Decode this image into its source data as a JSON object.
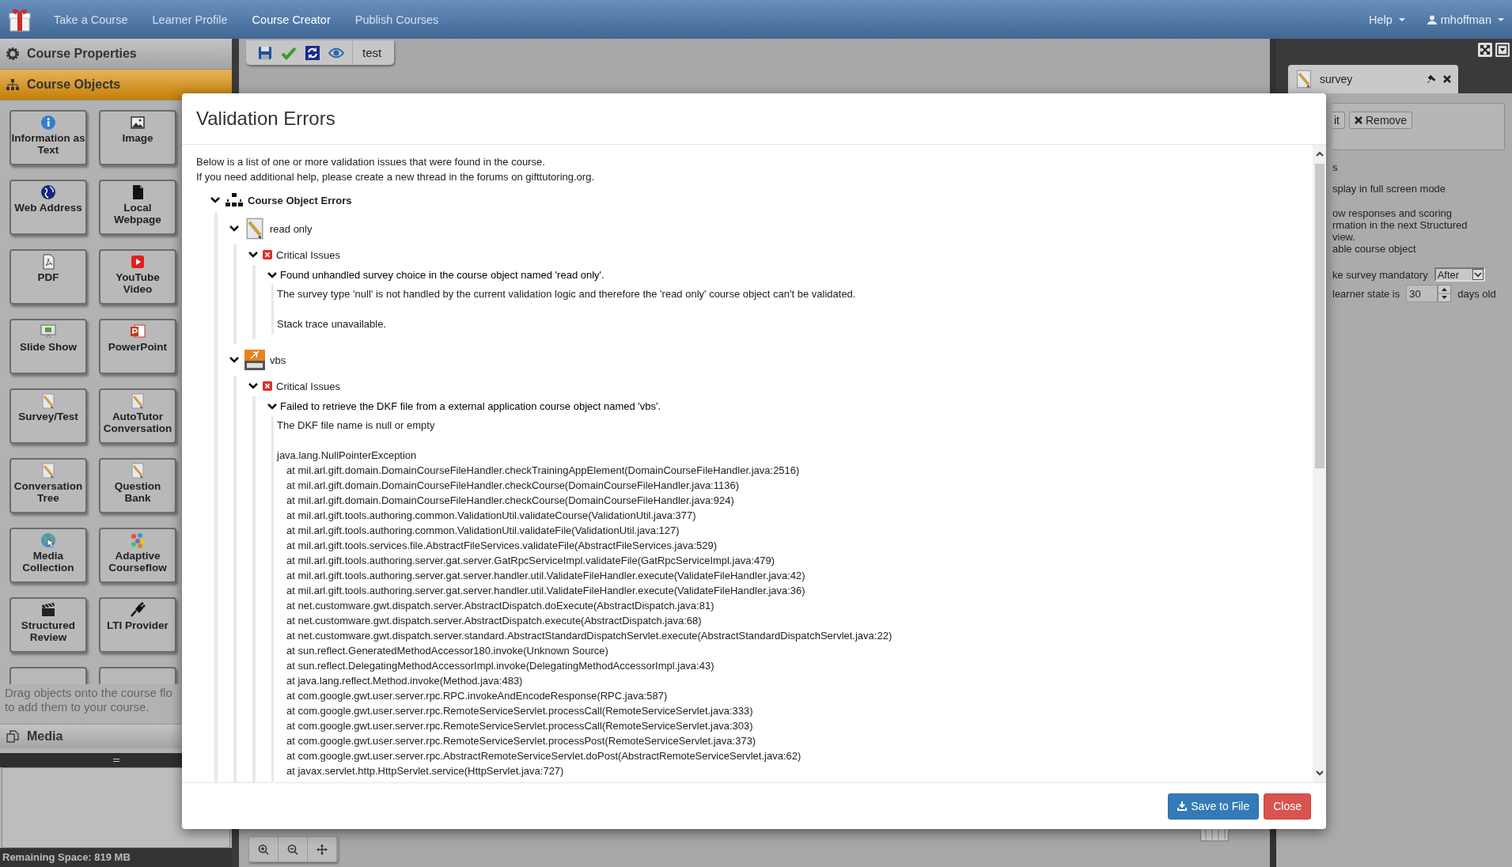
{
  "navbar": {
    "items": [
      {
        "label": "Take a Course",
        "selected": false
      },
      {
        "label": "Learner Profile",
        "selected": false
      },
      {
        "label": "Course Creator",
        "selected": true
      },
      {
        "label": "Publish Courses",
        "selected": false
      }
    ],
    "help": "Help",
    "user": "mhoffman"
  },
  "sidebar": {
    "sections": [
      {
        "label": "Course Properties",
        "selected": false
      },
      {
        "label": "Course Objects",
        "selected": true
      }
    ],
    "objects": [
      "Information as Text",
      "Image",
      "Web Address",
      "Local Webpage",
      "PDF",
      "YouTube Video",
      "Slide Show",
      "PowerPoint",
      "Survey/Test",
      "AutoTutor Conversation",
      "Conversation Tree",
      "Question Bank",
      "Media Collection",
      "Adaptive Courseflow",
      "Structured Review",
      "LTI Provider"
    ],
    "hint": [
      "Drag objects onto the course flo",
      "to add them to your course."
    ],
    "media": "Media",
    "storage": "Remaining Space: 819 MB"
  },
  "toolbar": {
    "course_name": "test"
  },
  "properties_panel": {
    "tab": "survey",
    "edit_fragment": "it",
    "remove": "Remove",
    "lines": [
      "s",
      "splay in full screen mode"
    ],
    "description": [
      "ow responses and scoring",
      "rmation in the next Structured",
      "view.",
      "able course object"
    ],
    "mandatory": {
      "label": "ke survey mandatory",
      "value": "After"
    },
    "age": {
      "label": "learner state is",
      "value": "30",
      "unit": "days old"
    }
  },
  "modal": {
    "title": "Validation Errors",
    "intro": [
      "Below is a list of one or more validation issues that were found in the course.",
      "If you need additional help, please create a new thread in the forums on gifttutoring.org."
    ],
    "tree": [
      {
        "kind": "category",
        "label": "Course Object Errors",
        "expanded": true,
        "children": [
          {
            "kind": "survey",
            "label": "read only",
            "expanded": true,
            "children": [
              {
                "kind": "critical",
                "label": "Critical Issues",
                "expanded": true,
                "children": [
                  {
                    "kind": "issue",
                    "label": "Found unhandled survey choice in the course object named 'read only'.",
                    "expanded": true,
                    "details": [
                      {
                        "text": "The survey type 'null' is not handled by the current validation logic and therefore the 'read only' course object can't be validated."
                      },
                      {
                        "text": "Stack trace unavailable."
                      }
                    ]
                  }
                ]
              }
            ]
          },
          {
            "kind": "application",
            "label": "vbs",
            "expanded": true,
            "children": [
              {
                "kind": "critical",
                "label": "Critical Issues",
                "expanded": true,
                "children": [
                  {
                    "kind": "issue",
                    "label": "Failed to retrieve the DKF file from a external application course object named 'vbs'.",
                    "expanded": true,
                    "details": [
                      {
                        "text": "The DKF file name is null or empty"
                      },
                      {
                        "text": "java.lang.NullPointerException",
                        "frames": [
                          "at mil.arl.gift.domain.DomainCourseFileHandler.checkTrainingAppElement(DomainCourseFileHandler.java:2516)",
                          "at mil.arl.gift.domain.DomainCourseFileHandler.checkCourse(DomainCourseFileHandler.java:1136)",
                          "at mil.arl.gift.domain.DomainCourseFileHandler.checkCourse(DomainCourseFileHandler.java:924)",
                          "at mil.arl.gift.tools.authoring.common.ValidationUtil.validateCourse(ValidationUtil.java:377)",
                          "at mil.arl.gift.tools.authoring.common.ValidationUtil.validateFile(ValidationUtil.java:127)",
                          "at mil.arl.gift.tools.services.file.AbstractFileServices.validateFile(AbstractFileServices.java:529)",
                          "at mil.arl.gift.tools.authoring.server.gat.server.GatRpcServiceImpl.validateFile(GatRpcServiceImpl.java:479)",
                          "at mil.arl.gift.tools.authoring.server.gat.server.handler.util.ValidateFileHandler.execute(ValidateFileHandler.java:42)",
                          "at mil.arl.gift.tools.authoring.server.gat.server.handler.util.ValidateFileHandler.execute(ValidateFileHandler.java:36)",
                          "at net.customware.gwt.dispatch.server.AbstractDispatch.doExecute(AbstractDispatch.java:81)",
                          "at net.customware.gwt.dispatch.server.AbstractDispatch.execute(AbstractDispatch.java:68)",
                          "at net.customware.gwt.dispatch.server.standard.AbstractStandardDispatchServlet.execute(AbstractStandardDispatchServlet.java:22)",
                          "at sun.reflect.GeneratedMethodAccessor180.invoke(Unknown Source)",
                          "at sun.reflect.DelegatingMethodAccessorImpl.invoke(DelegatingMethodAccessorImpl.java:43)",
                          "at java.lang.reflect.Method.invoke(Method.java:483)",
                          "at com.google.gwt.user.server.rpc.RPC.invokeAndEncodeResponse(RPC.java:587)",
                          "at com.google.gwt.user.server.rpc.RemoteServiceServlet.processCall(RemoteServiceServlet.java:333)",
                          "at com.google.gwt.user.server.rpc.RemoteServiceServlet.processCall(RemoteServiceServlet.java:303)",
                          "at com.google.gwt.user.server.rpc.RemoteServiceServlet.processPost(RemoteServiceServlet.java:373)",
                          "at com.google.gwt.user.server.rpc.AbstractRemoteServiceServlet.doPost(AbstractRemoteServiceServlet.java:62)",
                          "at javax.servlet.http.HttpServlet.service(HttpServlet.java:727)"
                        ]
                      }
                    ]
                  }
                ]
              }
            ]
          }
        ]
      }
    ],
    "buttons": [
      {
        "kind": "primary",
        "label": "Save to File"
      },
      {
        "kind": "danger",
        "label": "Close"
      }
    ]
  }
}
